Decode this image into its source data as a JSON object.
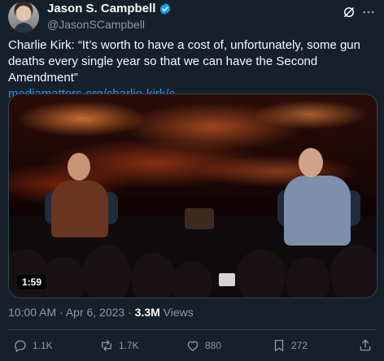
{
  "author": {
    "name": "Jason S. Campbell",
    "handle": "@JasonSCampbell"
  },
  "tweet": {
    "text": "Charlie Kirk: “It’s worth to have a cost of, unfortunately, some gun deaths every single year so that we can have the Second Amendment”",
    "link": "mediamatters.org/charlie-kirk/c…"
  },
  "media": {
    "duration": "1:59"
  },
  "meta": {
    "timestamp": "10:00 AM · Apr 6, 2023 · ",
    "views_count": "3.3M",
    "views_label": " Views"
  },
  "actions": {
    "replies": "1.1K",
    "reposts": "1.7K",
    "likes": "880",
    "bookmarks": "272"
  },
  "colors": {
    "background": "#15202b",
    "link": "#1d9bf0",
    "secondary_text": "#8b98a5",
    "verified": "#1d9bf0"
  }
}
